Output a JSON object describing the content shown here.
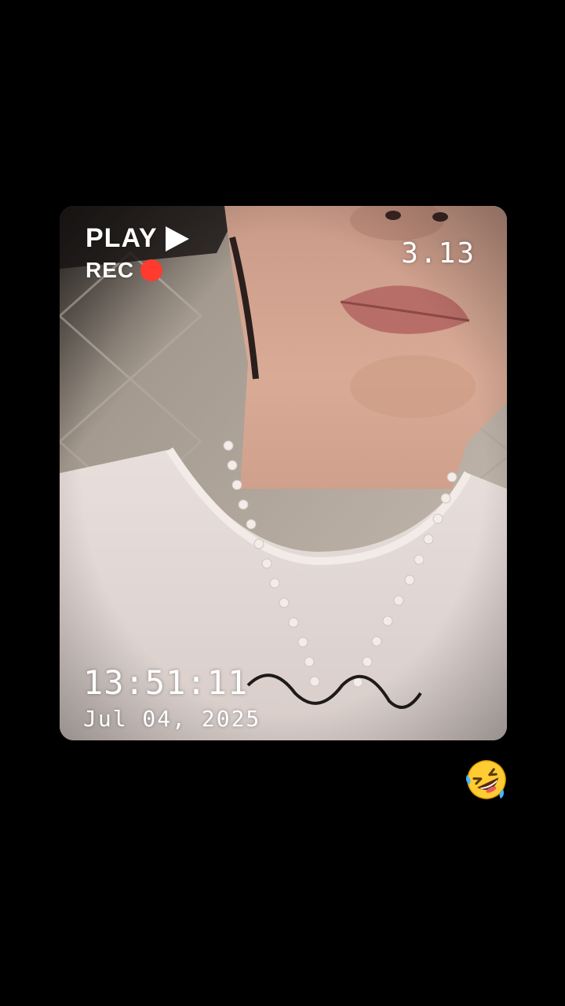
{
  "overlay": {
    "play_label": "PLAY",
    "rec_label": "REC",
    "counter": "3.13",
    "time": "13:51:11",
    "date": "Jul 04, 2025"
  },
  "sticker": {
    "icon": "rolling-on-floor-laughing-emoji-icon"
  },
  "colors": {
    "background": "#000000",
    "rec_dot": "#ff3b30",
    "overlay_text": "#ffffff"
  }
}
